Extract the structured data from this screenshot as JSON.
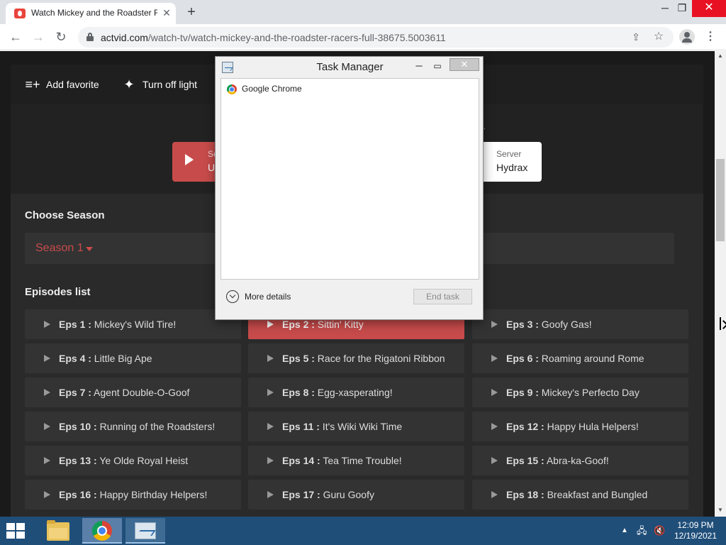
{
  "browser": {
    "tab_title": "Watch Mickey and the Roadster R",
    "url_host": "actvid.com",
    "url_path": "/watch-tv/watch-mickey-and-the-roadster-racers-full-38675.5003611"
  },
  "page": {
    "toolbar": {
      "add_favorite": "Add favorite",
      "turn_off_light": "Turn off light"
    },
    "server_note": "w.",
    "servers": {
      "active_label": "Se",
      "active_name": "U",
      "hydrax_label": "Server",
      "hydrax_name": "Hydrax"
    },
    "season_heading": "Choose Season",
    "season_value": "Season 1",
    "episodes_heading": "Episodes list",
    "episodes": [
      {
        "num": "Eps 1 :",
        "title": "Mickey's Wild Tire!"
      },
      {
        "num": "Eps 2 :",
        "title": "Sittin' Kitty",
        "active": true
      },
      {
        "num": "Eps 3 :",
        "title": "Goofy Gas!"
      },
      {
        "num": "Eps 4 :",
        "title": "Little Big Ape"
      },
      {
        "num": "Eps 5 :",
        "title": "Race for the Rigatoni Ribbon"
      },
      {
        "num": "Eps 6 :",
        "title": "Roaming around Rome"
      },
      {
        "num": "Eps 7 :",
        "title": "Agent Double-O-Goof"
      },
      {
        "num": "Eps 8 :",
        "title": "Egg-xasperating!"
      },
      {
        "num": "Eps 9 :",
        "title": "Mickey's Perfecto Day"
      },
      {
        "num": "Eps 10 :",
        "title": "Running of the Roadsters!"
      },
      {
        "num": "Eps 11 :",
        "title": "It's Wiki Wiki Time"
      },
      {
        "num": "Eps 12 :",
        "title": "Happy Hula Helpers!"
      },
      {
        "num": "Eps 13 :",
        "title": "Ye Olde Royal Heist"
      },
      {
        "num": "Eps 14 :",
        "title": "Tea Time Trouble!"
      },
      {
        "num": "Eps 15 :",
        "title": "Abra-ka-Goof!"
      },
      {
        "num": "Eps 16 :",
        "title": "Happy Birthday Helpers!"
      },
      {
        "num": "Eps 17 :",
        "title": "Guru Goofy"
      },
      {
        "num": "Eps 18 :",
        "title": "Breakfast and Bungled"
      }
    ]
  },
  "task_manager": {
    "title": "Task Manager",
    "process": "Google Chrome",
    "more_details": "More details",
    "end_task": "End task"
  },
  "taskbar": {
    "time": "12:09 PM",
    "date": "12/19/2021"
  },
  "colors": {
    "accent": "#c84b4b",
    "taskbar": "#1f4e79"
  }
}
